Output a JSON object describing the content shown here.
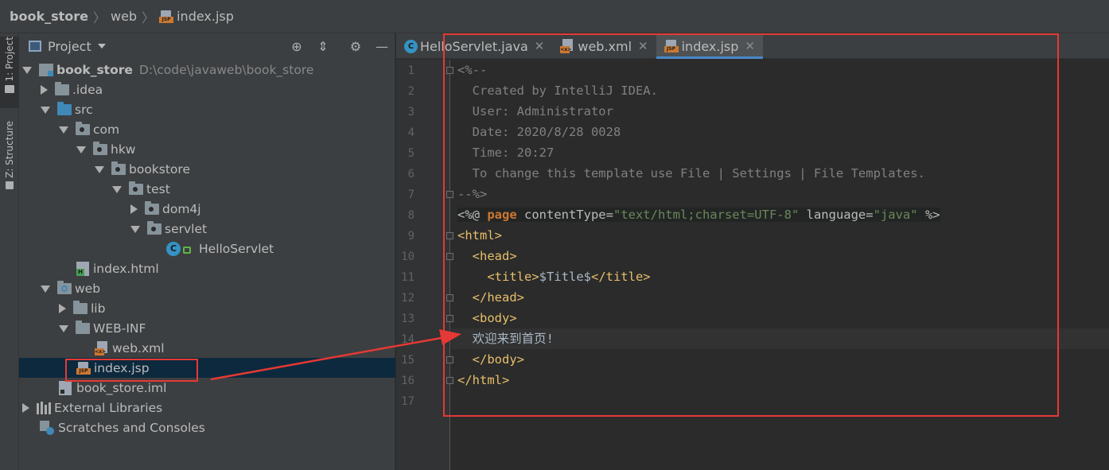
{
  "breadcrumb": {
    "project": "book_store",
    "folder": "web",
    "file": "index.jsp"
  },
  "toolstrip": {
    "project_tab": "1: Project",
    "structure_tab": "Z: Structure"
  },
  "project_panel": {
    "title": "Project",
    "tree": [
      {
        "label": "book_store",
        "path": "D:\\code\\javaweb\\book_store"
      },
      {
        "label": ".idea"
      },
      {
        "label": "src"
      },
      {
        "label": "com"
      },
      {
        "label": "hkw"
      },
      {
        "label": "bookstore"
      },
      {
        "label": "test"
      },
      {
        "label": "dom4j"
      },
      {
        "label": "servlet"
      },
      {
        "label": "HelloServlet"
      },
      {
        "label": "index.html"
      },
      {
        "label": "web"
      },
      {
        "label": "lib"
      },
      {
        "label": "WEB-INF"
      },
      {
        "label": "web.xml"
      },
      {
        "label": "index.jsp"
      },
      {
        "label": "book_store.iml"
      },
      {
        "label": "External Libraries"
      },
      {
        "label": "Scratches and Consoles"
      }
    ]
  },
  "tabs": [
    {
      "label": "HelloServlet.java",
      "icon": "class-icon"
    },
    {
      "label": "web.xml",
      "icon": "xml-file-icon"
    },
    {
      "label": "index.jsp",
      "icon": "jsp-file-icon",
      "active": true
    }
  ],
  "icon_text": {
    "class": "C",
    "jsp": "JSP",
    "xml": "<x>",
    "html": "H"
  },
  "editor": {
    "line_numbers": [
      "1",
      "2",
      "3",
      "4",
      "5",
      "6",
      "7",
      "8",
      "9",
      "10",
      "11",
      "12",
      "13",
      "14",
      "15",
      "16",
      "17"
    ],
    "lines": {
      "l1": "<%--",
      "l2": "  Created by IntelliJ IDEA.",
      "l3": "  User: Administrator",
      "l4": "  Date: 2020/8/28 0028",
      "l5": "  Time: 20:27",
      "l6": "  To change this template use File | Settings | File Templates.",
      "l7": "--%>",
      "l8_open": "<%@ ",
      "l8_kw": "page",
      "l8_attr1": " contentType=",
      "l8_val1": "\"text/html;charset=UTF-8\"",
      "l8_attr2": " language=",
      "l8_val2": "\"java\"",
      "l8_close": " %>",
      "l9": "<html>",
      "l10": "  <head>",
      "l11_indent": "    ",
      "l11_open": "<title>",
      "l11_text": "$Title$",
      "l11_close": "</title>",
      "l12": "  </head>",
      "l13": "  <body>",
      "l14": "  欢迎来到首页!",
      "l15": "  </body>",
      "l16": "</html>",
      "l17": ""
    }
  },
  "colors": {
    "annotation": "#e53935",
    "accent": "#4a88c7"
  }
}
